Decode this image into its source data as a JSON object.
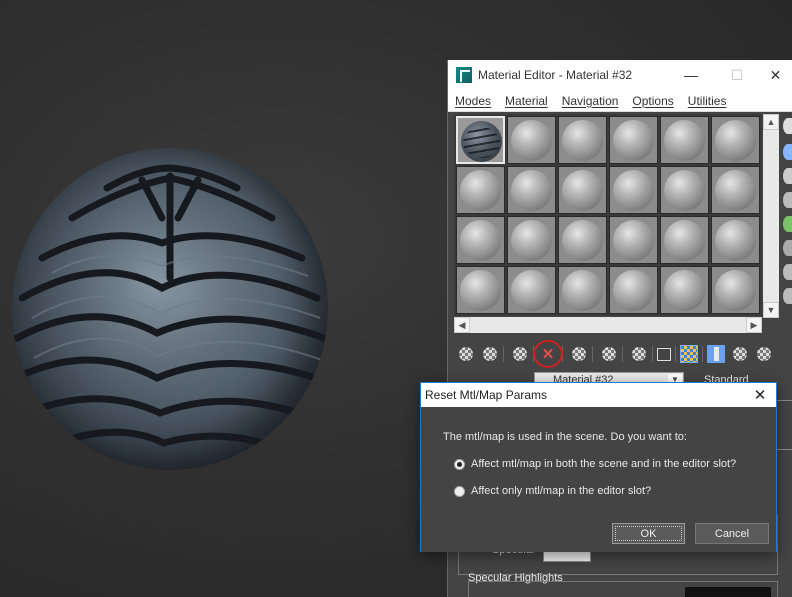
{
  "material_editor": {
    "title": "Material Editor - Material #32",
    "window_controls": {
      "minimize": "—",
      "maximize": "☐",
      "close": "✕"
    },
    "menus": [
      "Modes",
      "Material",
      "Navigation",
      "Options",
      "Utilities"
    ],
    "material_name": "Material #32",
    "material_type": "Standard",
    "specular_level_label": "Specular",
    "specular_highlights_label": "Specular Highlights",
    "scroll_up": "▲",
    "scroll_down": "▼",
    "scroll_left": "◀",
    "scroll_right": "▶",
    "dropdown_arrow": "▼"
  },
  "dialog": {
    "title": "Reset Mtl/Map Params",
    "close_glyph": "✕",
    "question": "The mtl/map is used in the scene. Do you want to:",
    "options": [
      {
        "label": "Affect mtl/map in both the scene and in the editor slot?",
        "selected": true
      },
      {
        "label": "Affect only mtl/map in the editor slot?",
        "selected": false
      }
    ],
    "ok_label": "OK",
    "cancel_label": "Cancel"
  },
  "toolbar": {
    "reset_glyph": "✕",
    "icons": [
      "get-material-icon",
      "put-to-scene-icon",
      "assign-to-selection-icon",
      "reset-map-icon",
      "make-copy-icon",
      "make-unique-icon",
      "put-to-library-icon",
      "material-id-icon",
      "show-in-viewport-icon",
      "show-end-result-icon",
      "go-to-parent-icon",
      "go-forward-sibling-icon"
    ]
  },
  "colors": {
    "accent_border": "#1d7ad6",
    "highlight_circle": "#d0201e",
    "panel_bg": "#444444"
  }
}
